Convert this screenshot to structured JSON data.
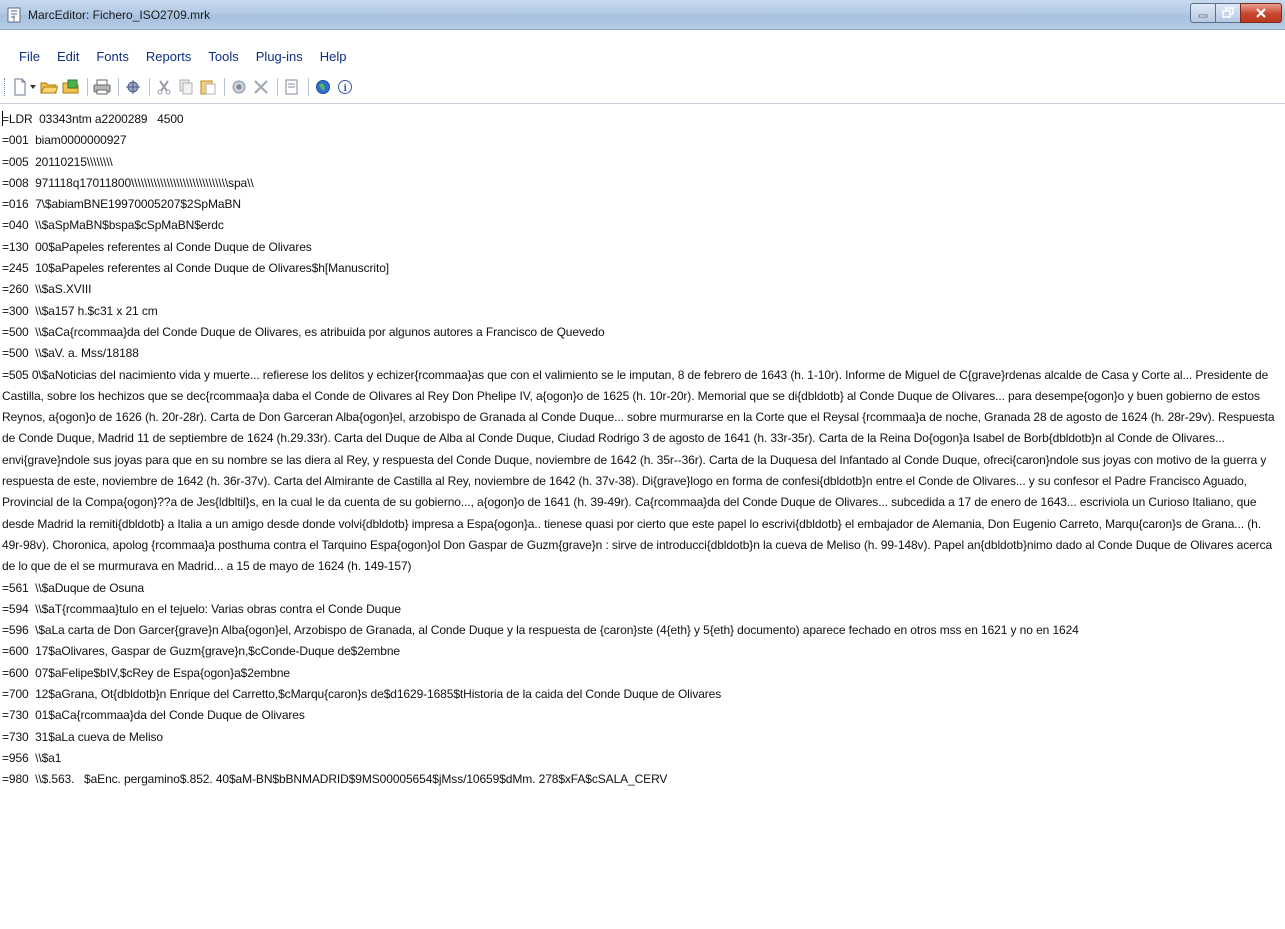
{
  "window": {
    "title": "MarcEditor: Fichero_ISO2709.mrk"
  },
  "menu": {
    "items": [
      "File",
      "Edit",
      "Fonts",
      "Reports",
      "Tools",
      "Plug-ins",
      "Help"
    ]
  },
  "toolbar": {
    "icons": [
      "new-file-icon",
      "dropdown-arrow-icon",
      "open-folder-icon",
      "save-icon",
      "print-icon",
      "spellcheck-icon",
      "cut-icon",
      "copy-icon",
      "paste-icon",
      "validate-icon",
      "delete-icon",
      "find-icon",
      "web-icon",
      "info-icon"
    ]
  },
  "editor": {
    "lines": [
      "=LDR  03343ntm a2200289   4500",
      "=001  biam0000000927",
      "=005  20110215\\\\\\\\\\\\\\\\",
      "=008  971118q17011800\\\\\\\\\\\\\\\\\\\\\\\\\\\\\\\\\\\\\\\\\\\\\\\\\\\\\\\\\\\\spa\\\\",
      "=016  7\\$abiamBNE19970005207$2SpMaBN",
      "=040  \\\\$aSpMaBN$bspa$cSpMaBN$erdc",
      "=130  00$aPapeles referentes al Conde Duque de Olivares",
      "=245  10$aPapeles referentes al Conde Duque de Olivares$h[Manuscrito]",
      "=260  \\\\$aS.XVIII",
      "=300  \\\\$a157 h.$c31 x 21 cm",
      "=500  \\\\$aCa{rcommaa}da del Conde Duque de Olivares, es atribuida por algunos autores a Francisco de Quevedo",
      "=500  \\\\$aV. a. Mss/18188",
      "=505  0\\$aNoticias del nacimiento vida y muerte... refierese los delitos y echizer{rcommaa}as que con el valimiento se le imputan, 8 de febrero de 1643 (h. 1-10r). Informe de Miguel de C{grave}rdenas alcalde de Casa y Corte al... Presidente de Castilla, sobre los hechizos que se dec{rcommaa}a daba el Conde de Olivares al Rey Don Phelipe IV, a{ogon}o de 1625 (h. 10r-20r). Memorial que se di{dbldotb} al Conde Duque de Olivares... para desempe{ogon}o y buen gobierno de estos Reynos, a{ogon}o de 1626 (h. 20r-28r). Carta de Don Garceran Alba{ogon}el, arzobispo de Granada al Conde Duque... sobre murmurarse en la Corte que el Reysal {rcommaa}a de noche, Granada 28 de agosto de 1624 (h. 28r-29v). Respuesta de Conde Duque, Madrid 11 de septiembre de 1624 (h.29.33r). Carta del Duque de Alba al Conde Duque, Ciudad Rodrigo 3 de agosto de 1641 (h. 33r-35r). Carta de la Reina Do{ogon}a Isabel de Borb{dbldotb}n al Conde de Olivares... envi{grave}ndole sus joyas para que en su nombre se las diera al Rey, y respuesta del Conde Duque, noviembre de 1642 (h. 35r--36r). Carta de la Duquesa del Infantado al Conde Duque, ofreci{caron}ndole sus joyas con motivo de la guerra y respuesta de este, noviembre de 1642 (h. 36r-37v). Carta del Almirante de Castilla al Rey, noviembre de 1642 (h. 37v-38). Di{grave}logo en forma de confesi{dbldotb}n entre el Conde de Olivares... y su confesor el Padre Francisco Aguado, Provincial de la Compa{ogon}??a de Jes{ldbltil}s, en la cual le da cuenta de su gobierno..., a{ogon}o de 1641 (h. 39-49r). Ca{rcommaa}da del Conde Duque de Olivares... subcedida a 17 de enero de 1643... escriviola un Curioso Italiano, que desde Madrid la remiti{dbldotb} a Italia a un amigo desde donde volvi{dbldotb} impresa a Espa{ogon}a.. tienese quasi por cierto que este papel lo escrivi{dbldotb} el embajador de Alemania, Don Eugenio Carreto, Marqu{caron}s de Grana... (h. 49r-98v). Choronica, apolog {rcommaa}a posthuma contra el Tarquino Espa{ogon}ol Don Gaspar de Guzm{grave}n : sirve de introducci{dbldotb}n la cueva de Meliso (h. 99-148v). Papel an{dbldotb}nimo dado al Conde Duque de Olivares acerca de lo que de el se murmurava en Madrid... a 15 de mayo de 1624 (h. 149-157)",
      "=561  \\\\$aDuque de Osuna",
      "=594  \\\\$aT{rcommaa}tulo en el tejuelo: Varias obras contra el Conde Duque",
      "=596  \\$aLa carta de Don Garcer{grave}n Alba{ogon}el, Arzobispo de Granada, al Conde Duque y la respuesta de {caron}ste (4{eth} y 5{eth} documento) aparece fechado en otros mss en 1621 y no en 1624",
      "=600  17$aOlivares, Gaspar de Guzm{grave}n,$cConde-Duque de$2embne",
      "=600  07$aFelipe$bIV,$cRey de Espa{ogon}a$2embne",
      "=700  12$aGrana, Ot{dbldotb}n Enrique del Carretto,$cMarqu{caron}s de$d1629-1685$tHistoria de la caida del Conde Duque de Olivares",
      "=730  01$aCa{rcommaa}da del Conde Duque de Olivares",
      "=730  31$aLa cueva de Meliso",
      "=956  \\\\$a1",
      "=980  \\\\$.563.   $aEnc. pergamino$.852. 40$aM-BN$bBNMADRID$9MS00005654$jMss/10659$dMm. 278$xFA$cSALA_CERV"
    ]
  }
}
